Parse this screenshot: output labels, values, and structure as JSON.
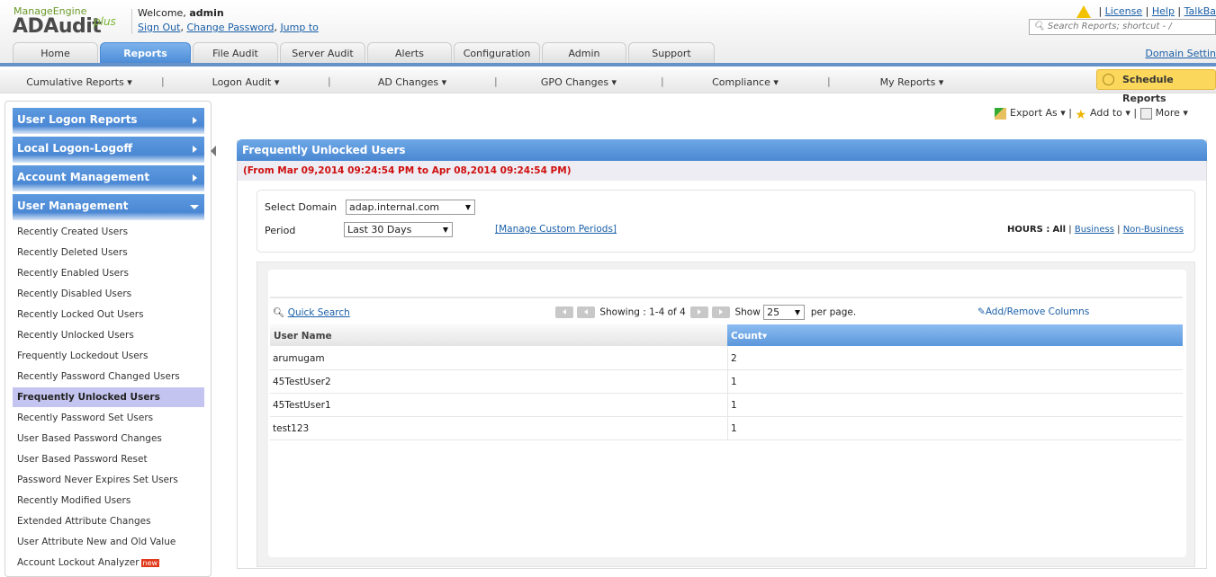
{
  "brand": {
    "company": "Manage",
    "company2": "Engine",
    "product": "ADAudit",
    "suffix": "plus"
  },
  "user": {
    "welcome": "Welcome,",
    "name": "admin",
    "sign_out": "Sign Out",
    "change_password": "Change Password",
    "jump_to": "Jump to"
  },
  "top_links": {
    "license": "License",
    "help": "Help",
    "talkback": "TalkBa"
  },
  "search": {
    "placeholder": "Search Reports; shortcut - /"
  },
  "domain_settings": "Domain Settin",
  "tabs": [
    "Home",
    "Reports",
    "File Audit",
    "Server Audit",
    "Alerts",
    "Configuration",
    "Admin",
    "Support"
  ],
  "active_tab": "Reports",
  "subnav": [
    "Cumulative Reports ▾",
    "Logon Audit ▾",
    "AD Changes ▾",
    "GPO Changes ▾",
    "Compliance ▾",
    "My Reports ▾"
  ],
  "schedule_reports": "Schedule Reports",
  "sidebar": {
    "groups": [
      "User Logon Reports",
      "Local Logon-Logoff",
      "Account Management",
      "User Management"
    ],
    "items": [
      "Recently Created Users",
      "Recently Deleted Users",
      "Recently Enabled Users",
      "Recently Disabled Users",
      "Recently Locked Out Users",
      "Recently Unlocked Users",
      "Frequently Lockedout Users",
      "Recently Password Changed Users",
      "Frequently Unlocked Users",
      "Recently Password Set Users",
      "User Based Password Changes",
      "User Based Password Reset",
      "Password Never Expires Set Users",
      "Recently Modified Users",
      "Extended Attribute Changes",
      "User Attribute New and Old Value",
      "Account Lockout Analyzer"
    ],
    "selected": "Frequently Unlocked Users",
    "new_badge": "new"
  },
  "actions": {
    "export": "Export As ▾",
    "add_to": "Add to ▾",
    "more": "More ▾"
  },
  "report": {
    "title": "Frequently Unlocked Users",
    "date_range": "(From Mar 09,2014 09:24:54 PM to Apr 08,2014 09:24:54 PM)",
    "domain_label": "Select Domain",
    "domain_value": "adap.internal.com",
    "period_label": "Period",
    "period_value": "Last 30 Days",
    "manage_periods": "[Manage Custom Periods]",
    "hours_label": "HOURS :",
    "hours_all": "All",
    "hours_business": "Business",
    "hours_nonbusiness": "Non-Business"
  },
  "table": {
    "quick_search": "Quick Search",
    "showing": "Showing :  1-4 of 4",
    "show": "Show",
    "per_page_value": "25",
    "per_page": "per page.",
    "add_remove": "Add/Remove Columns",
    "columns": [
      "User Name",
      "Count▾"
    ],
    "rows": [
      [
        "arumugam",
        "2"
      ],
      [
        "45TestUser2",
        "1"
      ],
      [
        "45TestUser1",
        "1"
      ],
      [
        "test123",
        "1"
      ]
    ]
  }
}
